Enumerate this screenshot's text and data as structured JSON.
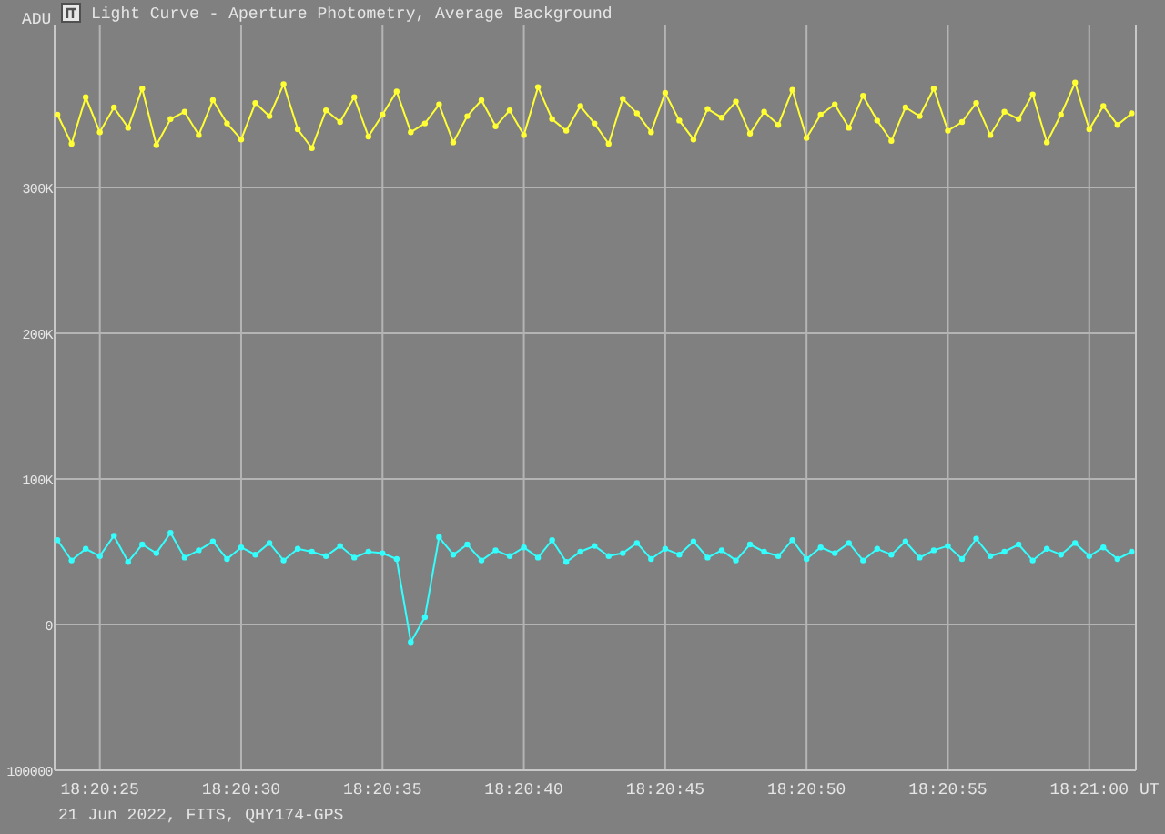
{
  "window": {
    "title": "Light Curve - Aperture Photometry, Average Background"
  },
  "chart_data": {
    "type": "line",
    "ylabel": "ADU",
    "xlabel": "UT",
    "categories": [
      null,
      null,
      null,
      "18:20:25",
      null,
      null,
      null,
      null,
      null,
      null,
      null,
      null,
      null,
      "18:20:30",
      null,
      null,
      null,
      null,
      null,
      null,
      null,
      null,
      null,
      "18:20:35",
      null,
      null,
      null,
      null,
      null,
      null,
      null,
      null,
      null,
      "18:20:40",
      null,
      null,
      null,
      null,
      null,
      null,
      null,
      null,
      null,
      "18:20:45",
      null,
      null,
      null,
      null,
      null,
      null,
      null,
      null,
      null,
      "18:20:50",
      null,
      null,
      null,
      null,
      null,
      null,
      null,
      null,
      null,
      "18:20:55",
      null,
      null,
      null,
      null,
      null,
      null,
      null,
      null,
      null,
      "18:21:00",
      null,
      null,
      null
    ],
    "series": [
      {
        "marker": true,
        "color": "#ffff33",
        "values": [
          350000,
          330000,
          362000,
          338000,
          355000,
          341000,
          368000,
          329000,
          347000,
          352000,
          336000,
          360000,
          344000,
          333000,
          358000,
          349000,
          371000,
          340000,
          327000,
          353000,
          345000,
          362000,
          335000,
          350000,
          366000,
          338000,
          344000,
          357000,
          331000,
          349000,
          360000,
          342000,
          353000,
          336000,
          369000,
          347000,
          339000,
          356000,
          344000,
          330000,
          361000,
          351000,
          338000,
          365000,
          346000,
          333000,
          354000,
          348000,
          359000,
          337000,
          352000,
          343000,
          367000,
          334000,
          350000,
          357000,
          341000,
          363000,
          346000,
          332000,
          355000,
          349000,
          368000,
          339000,
          345000,
          358000,
          336000,
          352000,
          347000,
          364000,
          331000,
          350000,
          372000,
          340000,
          356000,
          343000,
          351000
        ]
      },
      {
        "marker": true,
        "color": "#33ffff",
        "values": [
          58000,
          44000,
          52000,
          47000,
          61000,
          43000,
          55000,
          49000,
          63000,
          46000,
          51000,
          57000,
          45000,
          53000,
          48000,
          56000,
          44000,
          52000,
          50000,
          47000,
          54000,
          46000,
          50000,
          49000,
          45000,
          -12000,
          5000,
          60000,
          48000,
          55000,
          44000,
          51000,
          47000,
          53000,
          46000,
          58000,
          43000,
          50000,
          54000,
          47000,
          49000,
          56000,
          45000,
          52000,
          48000,
          57000,
          46000,
          51000,
          44000,
          55000,
          50000,
          47000,
          58000,
          45000,
          53000,
          49000,
          56000,
          44000,
          52000,
          48000,
          57000,
          46000,
          51000,
          54000,
          45000,
          59000,
          47000,
          50000,
          55000,
          44000,
          52000,
          48000,
          56000,
          47000,
          53000,
          45000,
          50000
        ]
      }
    ],
    "ylim": [
      -100000,
      411250
    ],
    "grid": true,
    "yticks": [
      {
        "value": 300000,
        "label": "300K"
      },
      {
        "value": 200000,
        "label": "200K"
      },
      {
        "value": 100000,
        "label": "100K"
      },
      {
        "value": 0,
        "label": "0"
      },
      {
        "value": -100000,
        "label": "100000"
      }
    ]
  },
  "footer": "21 Jun 2022, FITS, QHY174-GPS"
}
